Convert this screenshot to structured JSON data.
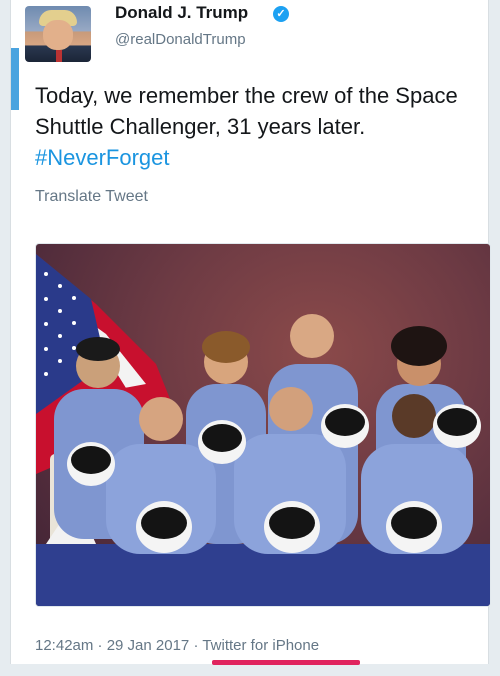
{
  "author": {
    "display_name": "Donald J. Trump",
    "handle": "@realDonaldTrump",
    "verified_icon": "check-badge-icon"
  },
  "tweet": {
    "text": "Today, we remember the crew of the Space Shuttle Challenger, 31 years later.",
    "hashtag": "#NeverForget",
    "translate_label": "Translate Tweet"
  },
  "meta": {
    "timestamp": "12:42am · 29 Jan 2017 · ",
    "source": "Twitter for iPhone"
  },
  "colors": {
    "link": "#1b95e0",
    "verified": "#1da1f2",
    "highlight": "#e0245e"
  }
}
